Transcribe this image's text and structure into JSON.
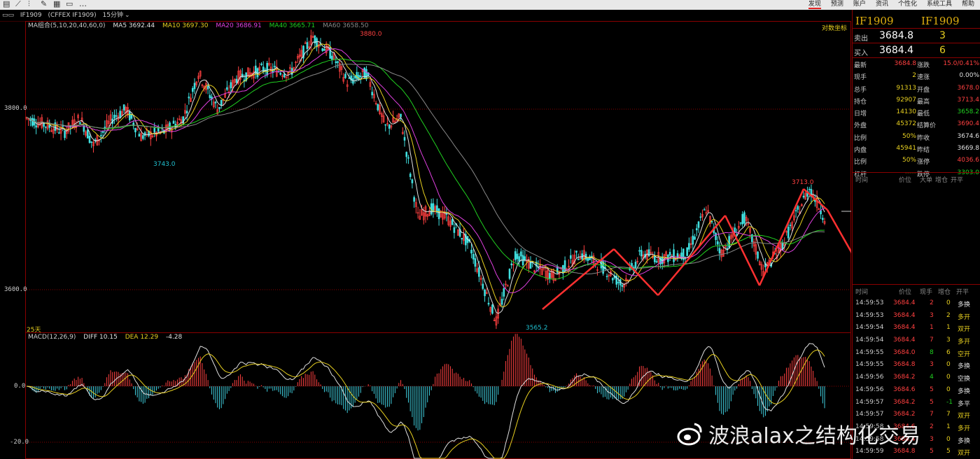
{
  "toolbar": {
    "icons": [
      "list-icon",
      "line-icon",
      "chart-icon",
      "draw-icon",
      "grid-icon",
      "window-icon",
      "more-icon"
    ],
    "menu": [
      "发现",
      "预测",
      "账户",
      "资讯",
      "个性化",
      "系统工具",
      "帮助"
    ]
  },
  "title_bar": {
    "contract": "IF1909",
    "exchange": "(CFFEX IF1909)",
    "period": "15分钟"
  },
  "main_chart": {
    "ma_legend": [
      {
        "label": "MA组合(5,10,20,40,60,0)",
        "color": "#cccccc"
      },
      {
        "label": "MA5 3692.44",
        "color": "#e0e0e0"
      },
      {
        "label": "MA10 3697.30",
        "color": "#e8d020"
      },
      {
        "label": "MA20 3686.91",
        "color": "#e040e0"
      },
      {
        "label": "MA40 3665.71",
        "color": "#20d020"
      },
      {
        "label": "MA60 3658.50",
        "color": "#888888"
      }
    ],
    "coord_toggle": "对数坐标",
    "yaxis": [
      "3800.0",
      "3600.0"
    ],
    "annotations": {
      "high1": "3880.0",
      "low1": "3743.0",
      "low2": "3565.2",
      "high2": "3713.0",
      "days": "25天"
    }
  },
  "macd": {
    "legend": [
      {
        "label": "MACD(12,26,9)",
        "color": "#cccccc"
      },
      {
        "label": "DIFF 10.15",
        "color": "#e0e0e0"
      },
      {
        "label": "DEA 12.29",
        "color": "#e8d020"
      },
      {
        "label": "-4.28",
        "color": "#e0e0e0"
      }
    ],
    "yaxis": [
      "0.0",
      "-20.0"
    ]
  },
  "quote": {
    "symbol_cn": "IF1909",
    "symbol": "IF1909",
    "ask": {
      "label": "卖出",
      "price": "3684.8",
      "vol": "3"
    },
    "bid": {
      "label": "买入",
      "price": "3684.4",
      "vol": "6"
    },
    "rows": [
      {
        "l1": "最新",
        "v1": "3684.8",
        "c1": "#ff4040",
        "l2": "涨跌",
        "v2": "15.0/0.41%",
        "c2": "#ff4040"
      },
      {
        "l1": "现手",
        "v1": "2",
        "c1": "#e8d020",
        "l2": "速涨",
        "v2": "0.00%",
        "c2": "#e0e0e0"
      },
      {
        "l1": "总手",
        "v1": "91313",
        "c1": "#e8d020",
        "l2": "开盘",
        "v2": "3678.0",
        "c2": "#ff4040"
      },
      {
        "l1": "持仓",
        "v1": "92907",
        "c1": "#e8d020",
        "l2": "最高",
        "v2": "3713.4",
        "c2": "#ff4040"
      },
      {
        "l1": "日增",
        "v1": "14130",
        "c1": "#e8d020",
        "l2": "最低",
        "v2": "3658.2",
        "c2": "#20d020"
      },
      {
        "l1": "外盘",
        "v1": "45372",
        "c1": "#e8d020",
        "l2": "结算价",
        "v2": "3690.4",
        "c2": "#ff4040"
      },
      {
        "l1": "比例",
        "v1": "50%",
        "c1": "#e8d020",
        "l2": "昨收",
        "v2": "3674.6",
        "c2": "#e0e0e0"
      },
      {
        "l1": "内盘",
        "v1": "45941",
        "c1": "#e8d020",
        "l2": "昨结",
        "v2": "3669.8",
        "c2": "#e0e0e0"
      },
      {
        "l1": "比例",
        "v1": "50%",
        "c1": "#e8d020",
        "l2": "涨停",
        "v2": "4036.6",
        "c2": "#ff4040"
      },
      {
        "l1": "杠杆",
        "v1": "-----",
        "c1": "#e8d020",
        "l2": "跌停",
        "v2": "3303.0",
        "c2": "#20d020"
      }
    ],
    "mini_head": [
      "时间",
      "价位",
      "大单",
      "增仓",
      "开平"
    ],
    "tick_head": [
      "时间",
      "价位",
      "现手",
      "增仓",
      "开平"
    ],
    "ticks": [
      {
        "t": "14:59:53",
        "p": "3684.4",
        "q": "2",
        "d": "0",
        "k": "多换"
      },
      {
        "t": "14:59:53",
        "p": "3684.4",
        "q": "3",
        "d": "2",
        "k": "多开"
      },
      {
        "t": "14:59:54",
        "p": "3684.4",
        "q": "1",
        "d": "1",
        "k": "双开"
      },
      {
        "t": "14:59:54",
        "p": "3684.4",
        "q": "7",
        "d": "3",
        "k": "多开"
      },
      {
        "t": "14:59:55",
        "p": "3684.0",
        "q": "8",
        "d": "6",
        "k": "空开"
      },
      {
        "t": "14:59:55",
        "p": "3684.8",
        "q": "3",
        "d": "0",
        "k": "多换"
      },
      {
        "t": "14:59:56",
        "p": "3684.2",
        "q": "4",
        "d": "0",
        "k": "空换"
      },
      {
        "t": "14:59:56",
        "p": "3684.6",
        "q": "5",
        "d": "0",
        "k": "多换"
      },
      {
        "t": "14:59:57",
        "p": "3684.2",
        "q": "5",
        "d": "-1",
        "k": "多平"
      },
      {
        "t": "14:59:57",
        "p": "3684.2",
        "q": "7",
        "d": "7",
        "k": "双开"
      },
      {
        "t": "14:59:58",
        "p": "3684.6",
        "q": "2",
        "d": "1",
        "k": "多开"
      },
      {
        "t": "14:59:58",
        "p": "3684.4",
        "q": "3",
        "d": "0",
        "k": "多换"
      },
      {
        "t": "14:59:59",
        "p": "3684.8",
        "q": "5",
        "d": "5",
        "k": "双开"
      }
    ]
  },
  "watermark": "波浪alax之结构化交易"
}
